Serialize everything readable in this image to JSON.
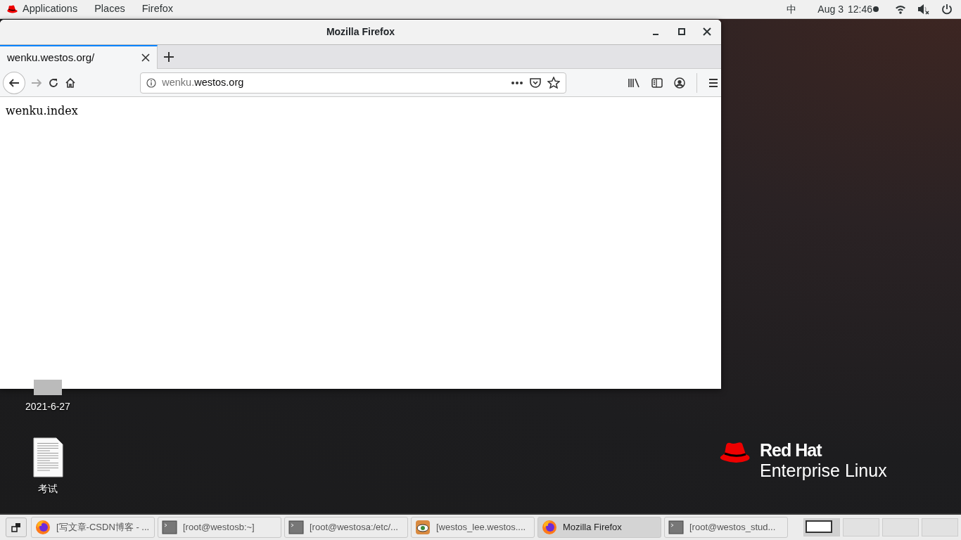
{
  "top_bar": {
    "menus": [
      "Applications",
      "Places",
      "Firefox"
    ],
    "input_method": "中",
    "date": "Aug 3",
    "time": "12:46"
  },
  "window": {
    "title": "Mozilla Firefox",
    "tabs": [
      {
        "label": "wenku.westos.org/",
        "selected": true
      }
    ],
    "url": {
      "prefix": "wenku.",
      "domain": "westos.org"
    },
    "page_text": "wenku.index"
  },
  "desktop_icons": [
    {
      "label": "2021-6-27",
      "kind": "hidden"
    },
    {
      "label": "考试",
      "kind": "document"
    }
  ],
  "logo": {
    "line_1": "Red Hat",
    "line_2": "Enterprise Linux"
  },
  "taskbar": {
    "items": [
      {
        "label": "[写文章-CSDN博客 - ...",
        "kind": "firefox",
        "selected": false
      },
      {
        "label": "[root@westosb:~]",
        "kind": "terminal",
        "selected": false
      },
      {
        "label": "[root@westosa:/etc/...",
        "kind": "terminal",
        "selected": false
      },
      {
        "label": "[westos_lee.westos....",
        "kind": "viewer",
        "selected": false
      },
      {
        "label": "Mozilla Firefox",
        "kind": "firefox",
        "selected": true
      },
      {
        "label": "[root@westos_stud...",
        "kind": "terminal",
        "selected": false
      }
    ],
    "workspaces": [
      {
        "selected": true
      },
      {
        "selected": false
      },
      {
        "selected": false
      },
      {
        "selected": false
      }
    ]
  }
}
